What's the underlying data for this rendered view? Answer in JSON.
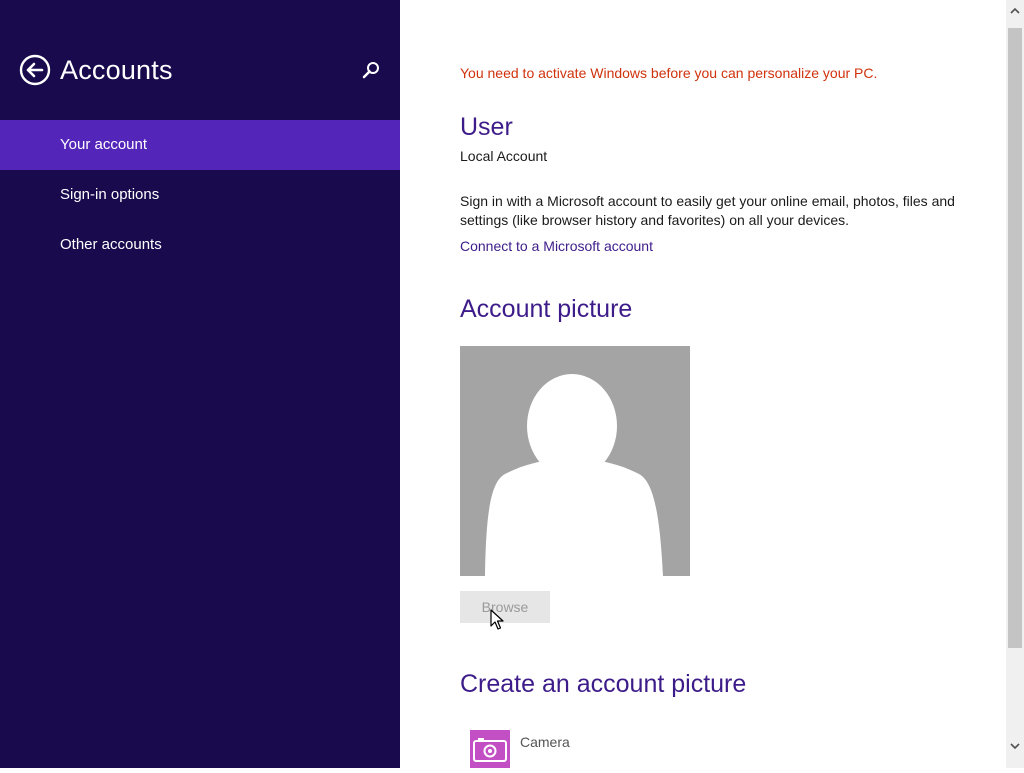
{
  "sidebar": {
    "title": "Accounts",
    "back_icon": "back-arrow-circle-icon",
    "search_icon": "search-icon",
    "items": [
      {
        "label": "Your account",
        "selected": true
      },
      {
        "label": "Sign-in options",
        "selected": false
      },
      {
        "label": "Other accounts",
        "selected": false
      }
    ],
    "colors": {
      "background": "#180a4c",
      "selected": "#5425b9"
    }
  },
  "main": {
    "activation_warning": "You need to activate Windows before you can personalize your PC.",
    "user": {
      "heading": "User",
      "account_type": "Local Account",
      "description": "Sign in with a Microsoft account to easily get your online email, photos, files and settings (like browser history and favorites) on all your devices.",
      "connect_link": "Connect to a Microsoft account"
    },
    "account_picture": {
      "heading": "Account picture",
      "avatar_icon": "default-user-silhouette-icon",
      "browse_label": "Browse"
    },
    "create_picture": {
      "heading": "Create an account picture",
      "apps": [
        {
          "label": "Camera",
          "icon": "camera-icon",
          "color": "#c250c4"
        }
      ]
    },
    "colors": {
      "heading": "#3d1c8a",
      "warning": "#d0320c",
      "link": "#3d1c8a"
    }
  }
}
